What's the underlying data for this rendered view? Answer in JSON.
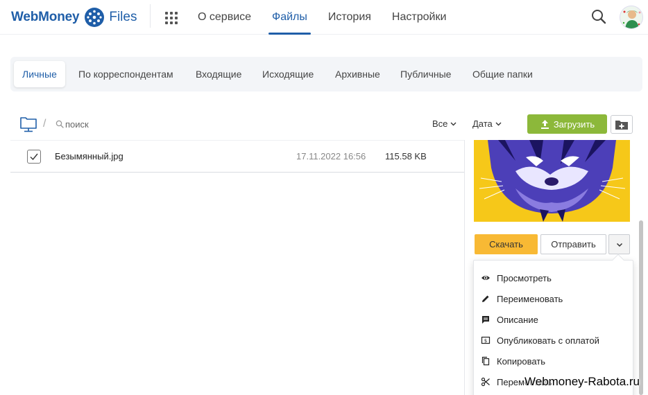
{
  "header": {
    "logo_text": "WebMoney",
    "logo_files": "Files",
    "nav": [
      {
        "label": "О сервисе"
      },
      {
        "label": "Файлы",
        "active": true
      },
      {
        "label": "История"
      },
      {
        "label": "Настройки"
      }
    ]
  },
  "tabs": [
    {
      "label": "Личные",
      "active": true
    },
    {
      "label": "По корреспондентам"
    },
    {
      "label": "Входящие"
    },
    {
      "label": "Исходящие"
    },
    {
      "label": "Архивные"
    },
    {
      "label": "Публичные"
    },
    {
      "label": "Общие папки"
    }
  ],
  "toolbar": {
    "breadcrumb_separator": "/",
    "search_placeholder": "поиск",
    "filter_all": "Все",
    "filter_date": "Дата",
    "upload_label": "Загрузить"
  },
  "files": [
    {
      "name": "Безымянный.jpg",
      "date": "17.11.2022 16:56",
      "size": "115.58 KB",
      "checked": true
    }
  ],
  "preview": {
    "download_label": "Скачать",
    "send_label": "Отправить"
  },
  "menu": [
    {
      "label": "Просмотреть",
      "icon": "eye-icon"
    },
    {
      "label": "Переименовать",
      "icon": "pencil-icon"
    },
    {
      "label": "Описание",
      "icon": "comment-icon"
    },
    {
      "label": "Опубликовать с оплатой",
      "icon": "paid-publish-icon"
    },
    {
      "label": "Копировать",
      "icon": "copy-icon"
    },
    {
      "label": "Переместить",
      "icon": "scissors-icon"
    }
  ],
  "watermark": "Webmoney-Rabota.ru",
  "colors": {
    "brand": "#1f5ea8",
    "upload": "#8cb83a",
    "download": "#f8b934",
    "preview_bg": "#f6c819"
  }
}
